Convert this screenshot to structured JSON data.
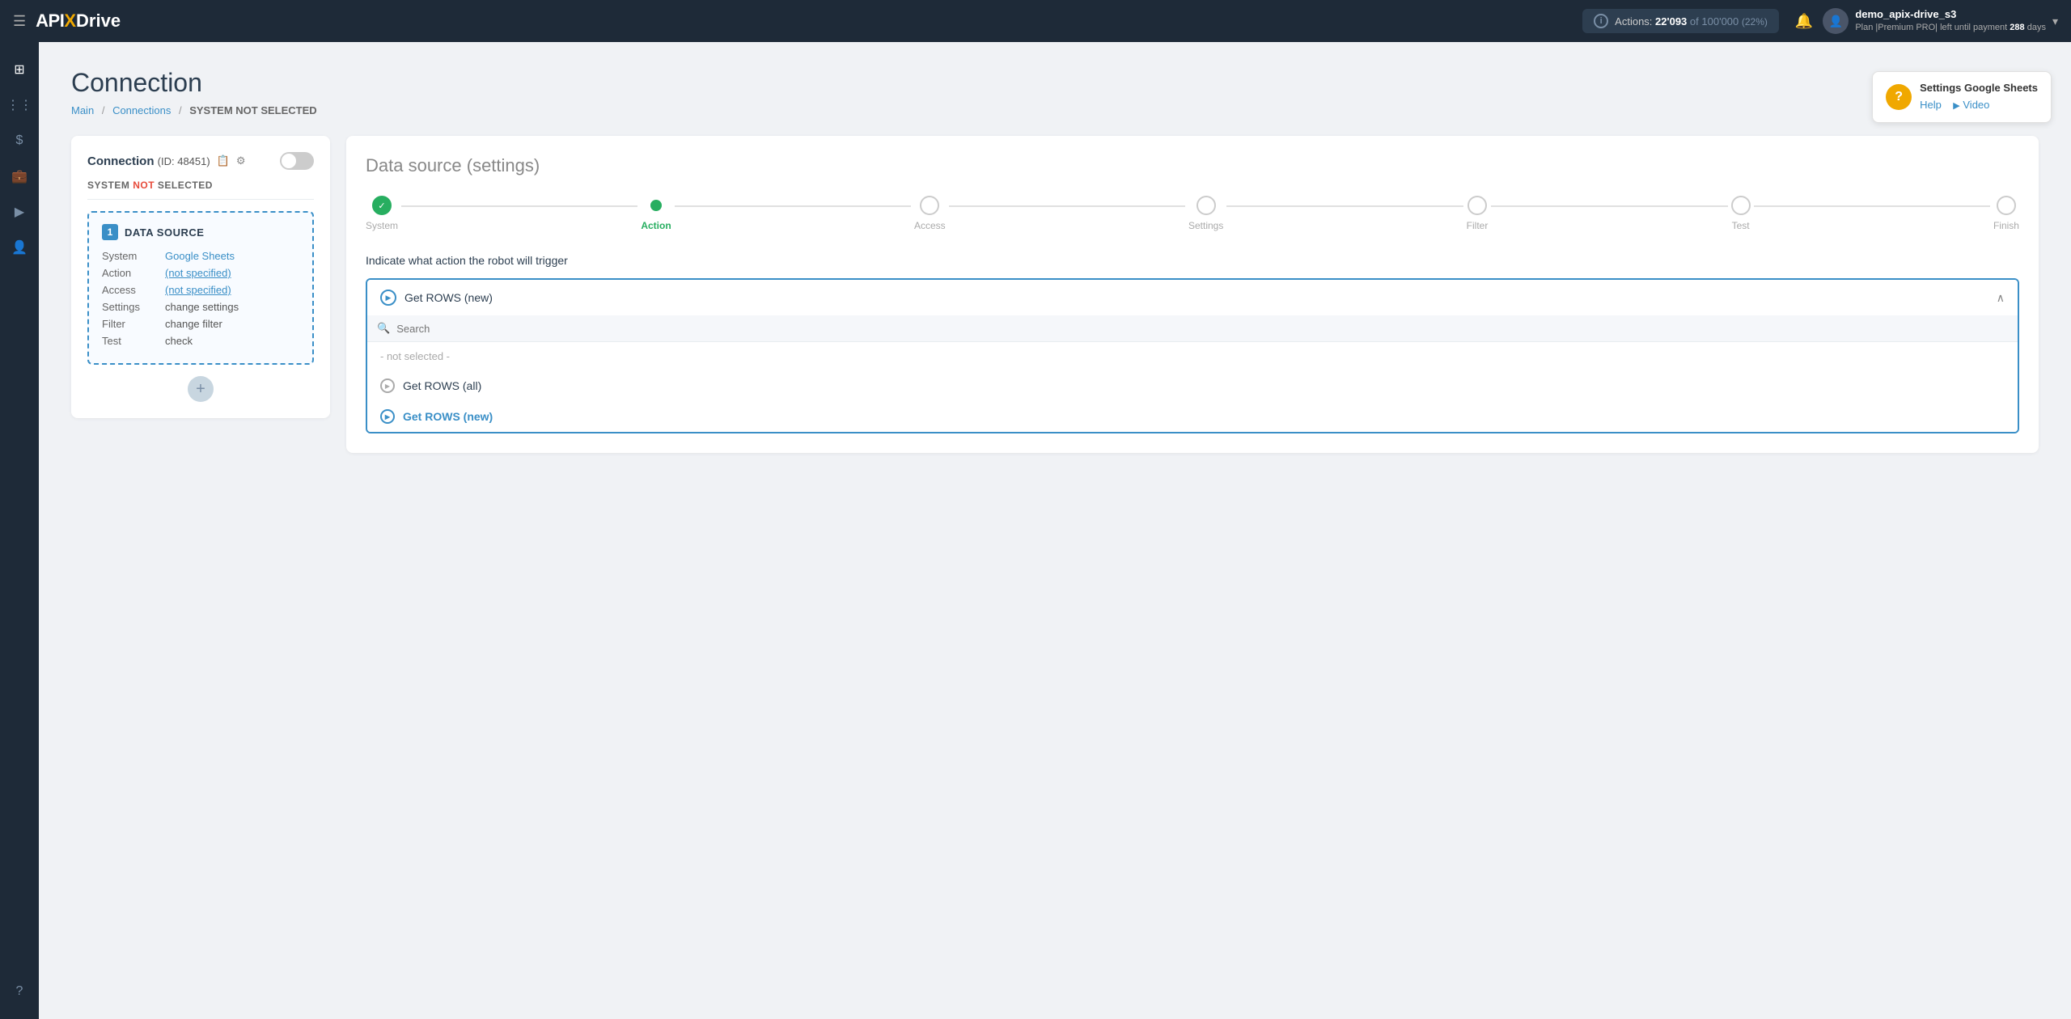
{
  "topbar": {
    "menu_icon": "☰",
    "logo_api": "API",
    "logo_x": "X",
    "logo_drive": "Drive",
    "actions_label": "Actions:",
    "actions_count": "22'093",
    "actions_of": "of",
    "actions_total": "100'000",
    "actions_pct": "(22%)",
    "bell_icon": "🔔",
    "user_name": "demo_apix-drive_s3",
    "plan_text": "Plan |Premium PRO| left until payment",
    "days": "288",
    "days_label": "days",
    "chevron": "▾"
  },
  "sidebar": {
    "items": [
      {
        "icon": "⊞",
        "name": "dashboard"
      },
      {
        "icon": "⋮⋮",
        "name": "connections"
      },
      {
        "icon": "$",
        "name": "billing"
      },
      {
        "icon": "💼",
        "name": "briefcase"
      },
      {
        "icon": "▶",
        "name": "play"
      },
      {
        "icon": "👤",
        "name": "profile"
      },
      {
        "icon": "?",
        "name": "help"
      }
    ]
  },
  "page": {
    "title": "Connection",
    "breadcrumb": {
      "main": "Main",
      "connections": "Connections",
      "current": "SYSTEM NOT SELECTED"
    }
  },
  "help_tooltip": {
    "icon": "?",
    "title": "Settings Google Sheets",
    "help_label": "Help",
    "video_icon": "▶",
    "video_label": "Video"
  },
  "left_panel": {
    "title_prefix": "Connection",
    "title_id": "(ID: 48451)",
    "copy_icon": "📋",
    "gear_icon": "⚙",
    "status_not": "NOT",
    "system_not_selected": "SYSTEM NOT SELECTED",
    "datasource": {
      "number": "1",
      "label": "DATA SOURCE",
      "rows": [
        {
          "key": "System",
          "value": "Google Sheets",
          "type": "link"
        },
        {
          "key": "Action",
          "value": "(not specified)",
          "type": "link"
        },
        {
          "key": "Access",
          "value": "(not specified)",
          "type": "link"
        },
        {
          "key": "Settings",
          "value": "change settings",
          "type": "plain"
        },
        {
          "key": "Filter",
          "value": "change filter",
          "type": "plain"
        },
        {
          "key": "Test",
          "value": "check",
          "type": "plain"
        }
      ]
    },
    "add_icon": "+"
  },
  "right_panel": {
    "title": "Data source",
    "title_sub": "(settings)",
    "steps": [
      {
        "label": "System",
        "state": "done"
      },
      {
        "label": "Action",
        "state": "active"
      },
      {
        "label": "Access",
        "state": "inactive"
      },
      {
        "label": "Settings",
        "state": "inactive"
      },
      {
        "label": "Filter",
        "state": "inactive"
      },
      {
        "label": "Test",
        "state": "inactive"
      },
      {
        "label": "Finish",
        "state": "inactive"
      }
    ],
    "action_hint": "Indicate what action the robot will trigger",
    "dropdown": {
      "selected": "Get ROWS (new)",
      "search_placeholder": "Search",
      "not_selected_label": "- not selected -",
      "options": [
        {
          "label": "Get ROWS (all)",
          "selected": false
        },
        {
          "label": "Get ROWS (new)",
          "selected": true
        }
      ]
    }
  }
}
